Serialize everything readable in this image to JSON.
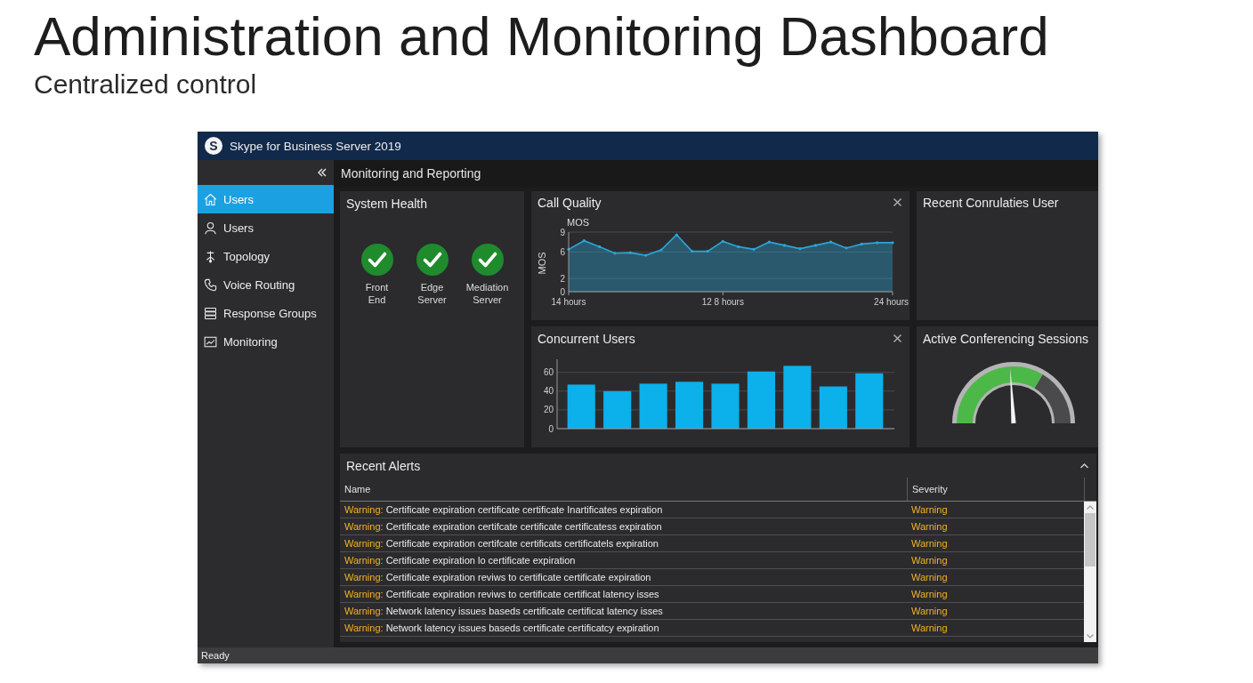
{
  "page": {
    "title": "Administration and Monitoring Dashboard",
    "subtitle": "Centralized control"
  },
  "window": {
    "logo": "S",
    "title": "Skype for Business Server 2019"
  },
  "sidebar": {
    "items": [
      {
        "label": "Users",
        "selected": true
      },
      {
        "label": "Users",
        "selected": false
      },
      {
        "label": "Topology",
        "selected": false
      },
      {
        "label": "Voice Routing",
        "selected": false
      },
      {
        "label": "Response Groups",
        "selected": false
      },
      {
        "label": "Monitoring",
        "selected": false
      }
    ]
  },
  "main": {
    "header": "Monitoring and Reporting"
  },
  "system_health": {
    "title": "System Health",
    "services": [
      {
        "label": "Front End",
        "healthy": true
      },
      {
        "label": "Edge Server",
        "healthy": true
      },
      {
        "label": "Mediation Server",
        "healthy": true
      }
    ]
  },
  "call_quality": {
    "title": "Call Quality",
    "chart_data": {
      "type": "area",
      "title": "MOS",
      "ylabel": "MOS",
      "categories": [
        "14 hours",
        null,
        null,
        null,
        null,
        null,
        null,
        null,
        null,
        null,
        "12 8 hours",
        null,
        null,
        null,
        null,
        null,
        null,
        null,
        null,
        null,
        null,
        "24 hours"
      ],
      "series": [
        {
          "color": "#2ba5d8",
          "values": [
            6.4,
            7.7,
            6.8,
            5.8,
            5.9,
            5.5,
            6.3,
            8.6,
            6.1,
            6.1,
            7.6,
            6.8,
            6.4,
            7.5,
            7.0,
            6.5,
            7.0,
            7.5,
            6.6,
            7.2,
            7.4,
            7.4
          ]
        }
      ],
      "ylim": [
        0,
        9
      ],
      "yticks": [
        0,
        2,
        6,
        9
      ],
      "grid": true
    }
  },
  "recent_users": {
    "title": "Recent Conrulaties User"
  },
  "concurrent_users": {
    "title": "Concurrent Users",
    "chart_data": {
      "type": "bar",
      "values": [
        47,
        40,
        48,
        50,
        48,
        61,
        67,
        45,
        59
      ],
      "ylim": [
        0,
        74
      ],
      "yticks": [
        0,
        20,
        40,
        60
      ],
      "grid": true
    }
  },
  "conferencing": {
    "title": "Active Conferencing Sessions",
    "gauge": {
      "band": {
        "level": 0.67
      },
      "needle": {
        "level": 0.48
      }
    }
  },
  "alerts": {
    "title": "Recent Alerts",
    "expanded": true,
    "columns": [
      "Name",
      "Severity"
    ],
    "rows": [
      {
        "prefix": "Warning:",
        "message": "Certificate expiration certificate certificate Inartificates expiration",
        "severity": "Warning"
      },
      {
        "prefix": "Warning:",
        "message": "Certificate expiration certifcate certificate certificatess expiration",
        "severity": "Warning"
      },
      {
        "prefix": "Warning:",
        "message": "Certificate expiration certifcate certificats certificatels expiration",
        "severity": "Warning"
      },
      {
        "prefix": "Warning:",
        "message": "Certificate expiration lo certificate expiration",
        "severity": "Warning"
      },
      {
        "prefix": "Warning:",
        "message": "Certificate expiration reviws to certificate certificate expiration",
        "severity": "Warning"
      },
      {
        "prefix": "Warning:",
        "message": "Certificate expiration reviws to certificate certificat latency isses",
        "severity": "Warning"
      },
      {
        "prefix": "Warning:",
        "message": "Network latency issues baseds certificate certificat latency isses",
        "severity": "Warning"
      },
      {
        "prefix": "Warning:",
        "message": "Network latency issues baseds certificate certificatcy expiration",
        "severity": "Warning"
      }
    ]
  },
  "status_bar": {
    "text": "Ready"
  }
}
